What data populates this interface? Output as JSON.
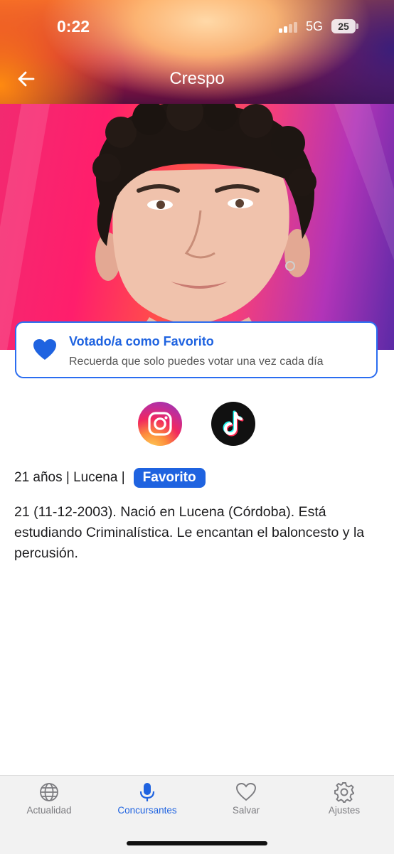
{
  "status_bar": {
    "time": "0:22",
    "network": "5G",
    "battery": "25"
  },
  "header": {
    "title": "Crespo"
  },
  "vote": {
    "title": "Votado/a como Favorito",
    "subtitle": "Recuerda que solo puedes votar una vez cada día"
  },
  "social": {
    "icons": [
      "instagram-icon",
      "tiktok-icon"
    ]
  },
  "info": {
    "meta": "21 años | Lucena |",
    "badge": "Favorito",
    "bio": "21 (11-12-2003). Nació en Lucena (Córdoba). Está estudiando Criminalística. Le encantan el baloncesto y la percusión."
  },
  "tabs": [
    {
      "label": "Actualidad",
      "icon": "globe-icon"
    },
    {
      "label": "Concursantes",
      "icon": "microphone-icon",
      "active": true
    },
    {
      "label": "Salvar",
      "icon": "heart-icon"
    },
    {
      "label": "Ajustes",
      "icon": "gear-icon"
    }
  ],
  "colors": {
    "accent": "#1f63e0",
    "badge": "#1f63e0"
  }
}
